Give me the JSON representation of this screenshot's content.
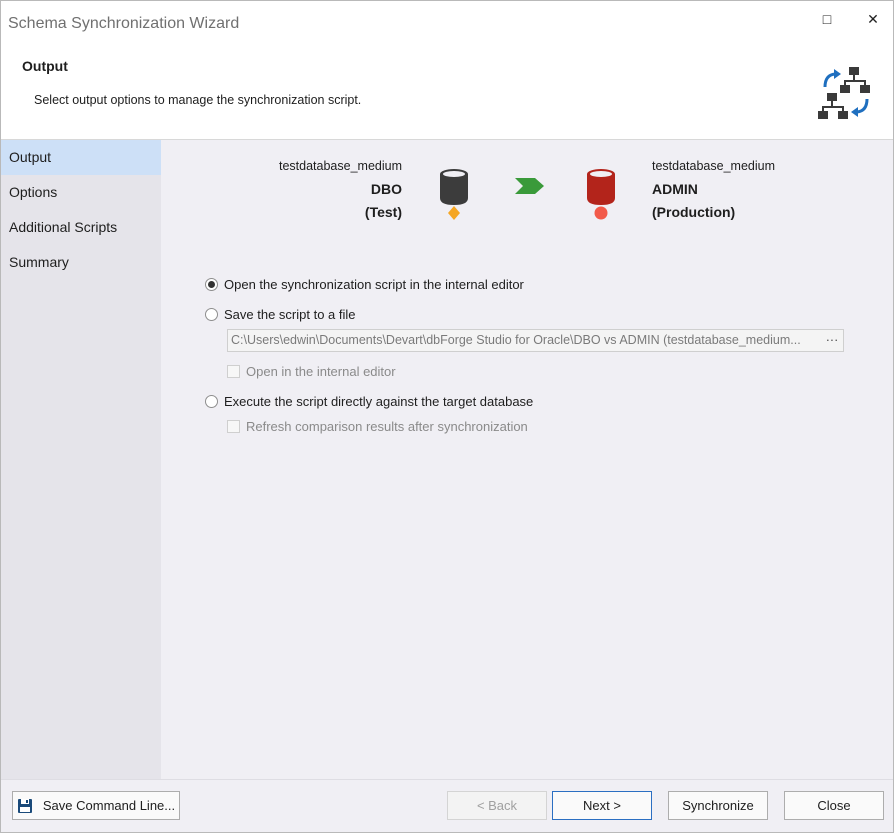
{
  "window": {
    "title": "Schema Synchronization Wizard",
    "maximize_glyph": "□",
    "close_glyph": "✕"
  },
  "header": {
    "title": "Output",
    "description": "Select output options to manage the synchronization script.",
    "logo_icon": "schema-sync-icon"
  },
  "sidebar": {
    "items": [
      {
        "label": "Output",
        "active": true
      },
      {
        "label": "Options"
      },
      {
        "label": "Additional Scripts"
      },
      {
        "label": "Summary"
      }
    ]
  },
  "source": {
    "connection": "testdatabase_medium",
    "schema": "DBO",
    "environment": "(Test)",
    "icon": "database-icon",
    "marker_color": "#f5a623",
    "db_color": "#3c3c3c"
  },
  "target": {
    "connection": "testdatabase_medium",
    "schema": "ADMIN",
    "environment": "(Production)",
    "icon": "database-icon",
    "marker_color": "#f25a4a",
    "db_color": "#b3241b"
  },
  "arrow_color": "#3a9a3a",
  "options": {
    "open_internal": "Open the synchronization script in the internal editor",
    "save_to_file": "Save the script to a file",
    "file_path": "C:\\Users\\edwin\\Documents\\Devart\\dbForge Studio for Oracle\\DBO vs ADMIN (testdatabase_medium...",
    "browse": "···",
    "open_in_editor": "Open in the internal editor",
    "execute_directly": "Execute the script directly against the target database",
    "refresh_results": "Refresh comparison results after synchronization",
    "selected": "open_internal"
  },
  "footer": {
    "save_command_line": "Save Command Line...",
    "back": "< Back",
    "next": "Next >",
    "synchronize": "Synchronize",
    "close": "Close"
  }
}
